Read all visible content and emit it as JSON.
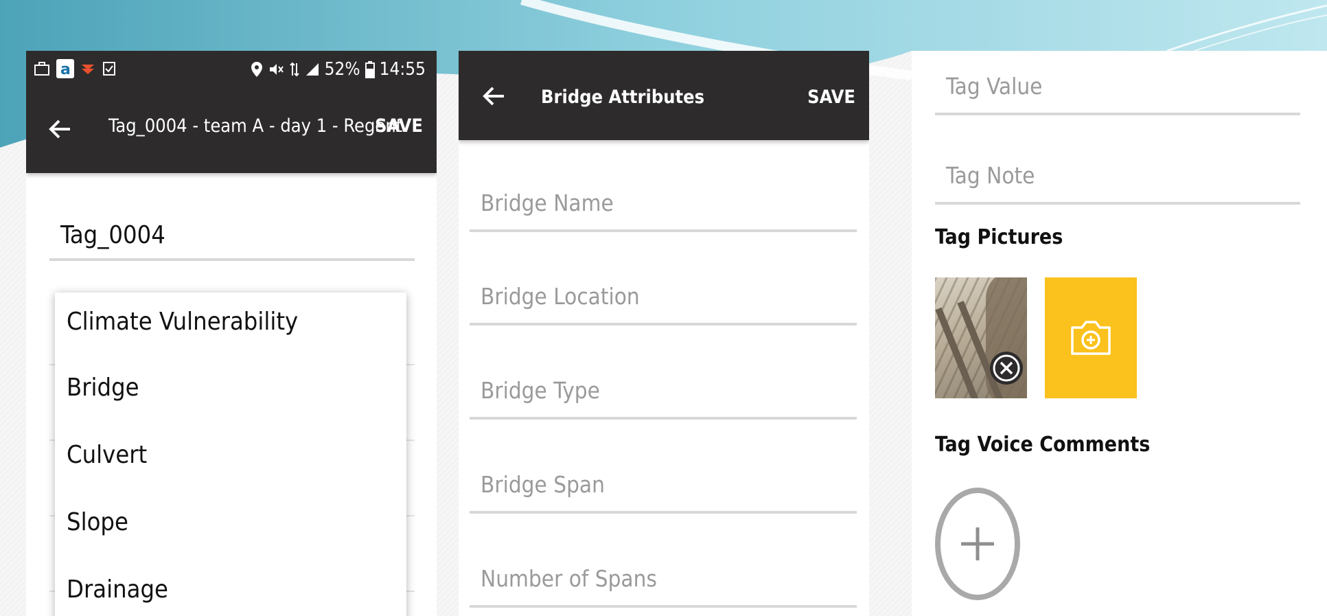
{
  "panel_tag": {
    "status_bar": {
      "battery": "52%",
      "time": "14:55"
    },
    "title": "Tag_0004 - team A - day 1 - Regent",
    "save_label": "SAVE",
    "tag_name_value": "Tag_0004",
    "dropdown_options": [
      "Climate Vulnerability",
      "Bridge",
      "Culvert",
      "Slope",
      "Drainage"
    ]
  },
  "panel_bridge": {
    "title": "Bridge Attributes",
    "save_label": "SAVE",
    "fields": [
      {
        "placeholder": "Bridge Name"
      },
      {
        "placeholder": "Bridge Location"
      },
      {
        "placeholder": "Bridge Type"
      },
      {
        "placeholder": "Bridge Span"
      },
      {
        "placeholder": "Number of Spans"
      }
    ]
  },
  "panel_details": {
    "tag_value_placeholder": "Tag Value",
    "tag_note_placeholder": "Tag Note",
    "pictures_heading": "Tag Pictures",
    "voice_heading": "Tag Voice Comments",
    "icons": {
      "remove_photo": "close-icon",
      "add_photo": "camera-plus-icon",
      "add_voice": "plus-icon"
    },
    "colors": {
      "camera_button": "#fbc11c",
      "app_bar": "#2d2b2b"
    }
  }
}
